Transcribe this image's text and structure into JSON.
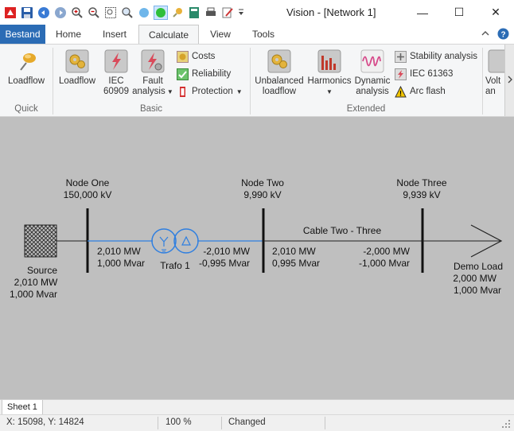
{
  "window": {
    "title": "Vision - [Network 1]",
    "min": "—",
    "max": "☐",
    "close": "✕"
  },
  "tabs": [
    {
      "label": "Bestand"
    },
    {
      "label": "Home"
    },
    {
      "label": "Insert"
    },
    {
      "label": "Calculate"
    },
    {
      "label": "View"
    },
    {
      "label": "Tools"
    }
  ],
  "ribbon": {
    "quick": {
      "loadflow": "Loadflow",
      "group": "Quick"
    },
    "basic": {
      "loadflow": "Loadflow",
      "iec60909_l1": "IEC",
      "iec60909_l2": "60909",
      "fault_l1": "Fault",
      "fault_l2": "analysis",
      "costs": "Costs",
      "reliability": "Reliability",
      "protection": "Protection",
      "group": "Basic"
    },
    "extended": {
      "unbal_l1": "Unbalanced",
      "unbal_l2": "loadflow",
      "harmonics": "Harmonics",
      "dyn_l1": "Dynamic",
      "dyn_l2": "analysis",
      "stability": "Stability analysis",
      "iec61363": "IEC 61363",
      "arcflash": "Arc flash",
      "group": "Extended"
    },
    "more_l1": "Volt",
    "more_l2": "an"
  },
  "diagram": {
    "node_one": {
      "name": "Node One",
      "voltage": "150,000 kV"
    },
    "node_two": {
      "name": "Node Two",
      "voltage": "9,990 kV"
    },
    "node_three": {
      "name": "Node Three",
      "voltage": "9,939 kV"
    },
    "source": {
      "name": "Source",
      "p": "2,010 MW",
      "q": "1,000 Mvar"
    },
    "trafo": {
      "name": "Trafo 1",
      "from_p": "2,010 MW",
      "from_q": "1,000 Mvar",
      "to_p": "-2,010 MW",
      "to_q": "-0,995 Mvar"
    },
    "cable": {
      "name": "Cable Two - Three",
      "from_p": "2,010 MW",
      "from_q": "0,995 Mvar",
      "to_p": "-2,000 MW",
      "to_q": "-1,000 Mvar"
    },
    "load": {
      "name": "Demo Load",
      "p": "2,000 MW",
      "q": "1,000 Mvar"
    }
  },
  "sheet": {
    "tab": "Sheet 1"
  },
  "status": {
    "coords": "X: 15098, Y: 14824",
    "zoom": "100 %",
    "state": "Changed"
  }
}
